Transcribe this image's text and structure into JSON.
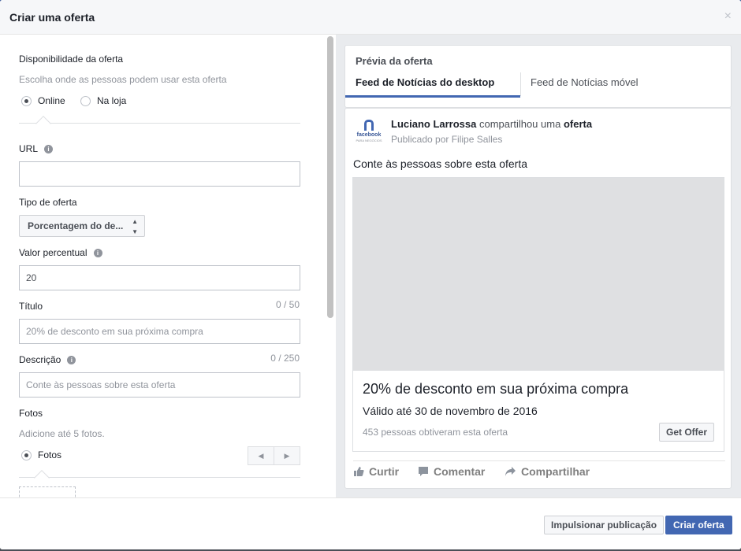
{
  "dialog": {
    "title": "Criar uma oferta",
    "close_glyph": "×"
  },
  "form": {
    "availability": {
      "label": "Disponibilidade da oferta",
      "help": "Escolha onde as pessoas podem usar esta oferta",
      "options": [
        {
          "label": "Online",
          "selected": true
        },
        {
          "label": "Na loja",
          "selected": false
        }
      ]
    },
    "url": {
      "label": "URL",
      "value": ""
    },
    "offer_type": {
      "label": "Tipo de oferta",
      "selected": "Porcentagem do de...",
      "arrows": "▲▼"
    },
    "percent_value": {
      "label": "Valor percentual",
      "value": "20"
    },
    "title": {
      "label": "Título",
      "counter": "0 / 50",
      "placeholder": "20% de desconto em sua próxima compra"
    },
    "description": {
      "label": "Descrição",
      "counter": "0 / 250",
      "placeholder": "Conte às pessoas sobre esta oferta"
    },
    "photos": {
      "label": "Fotos",
      "help": "Adicione até 5 fotos.",
      "option": "Fotos",
      "prev_glyph": "◀",
      "next_glyph": "▶"
    },
    "info_glyph": "i"
  },
  "preview": {
    "title": "Prévia da oferta",
    "tabs": [
      {
        "label": "Feed de Notícias do desktop",
        "active": true
      },
      {
        "label": "Feed de Notícias móvel",
        "active": false
      }
    ],
    "post": {
      "page_logo_word": "facebook",
      "page_logo_sub": "PARA NEGÓCIOS",
      "author": "Luciano Larrossa",
      "shared_text": " compartilhou uma ",
      "shared_object": "oferta",
      "published_by": "Publicado por Filipe Salles",
      "body": "Conte às pessoas sobre esta oferta",
      "offer_title": "20% de desconto em sua próxima compra",
      "offer_valid": "Válido até 30 de novembro de 2016",
      "offer_claimed": "453 pessoas obtiveram esta oferta",
      "get_offer": "Get Offer",
      "actions": [
        "Curtir",
        "Comentar",
        "Compartilhar"
      ]
    }
  },
  "footer": {
    "boost": "Impulsionar publicação",
    "create": "Criar oferta"
  },
  "colors": {
    "accent": "#4267b2",
    "panel_bg": "#e9ebee"
  }
}
